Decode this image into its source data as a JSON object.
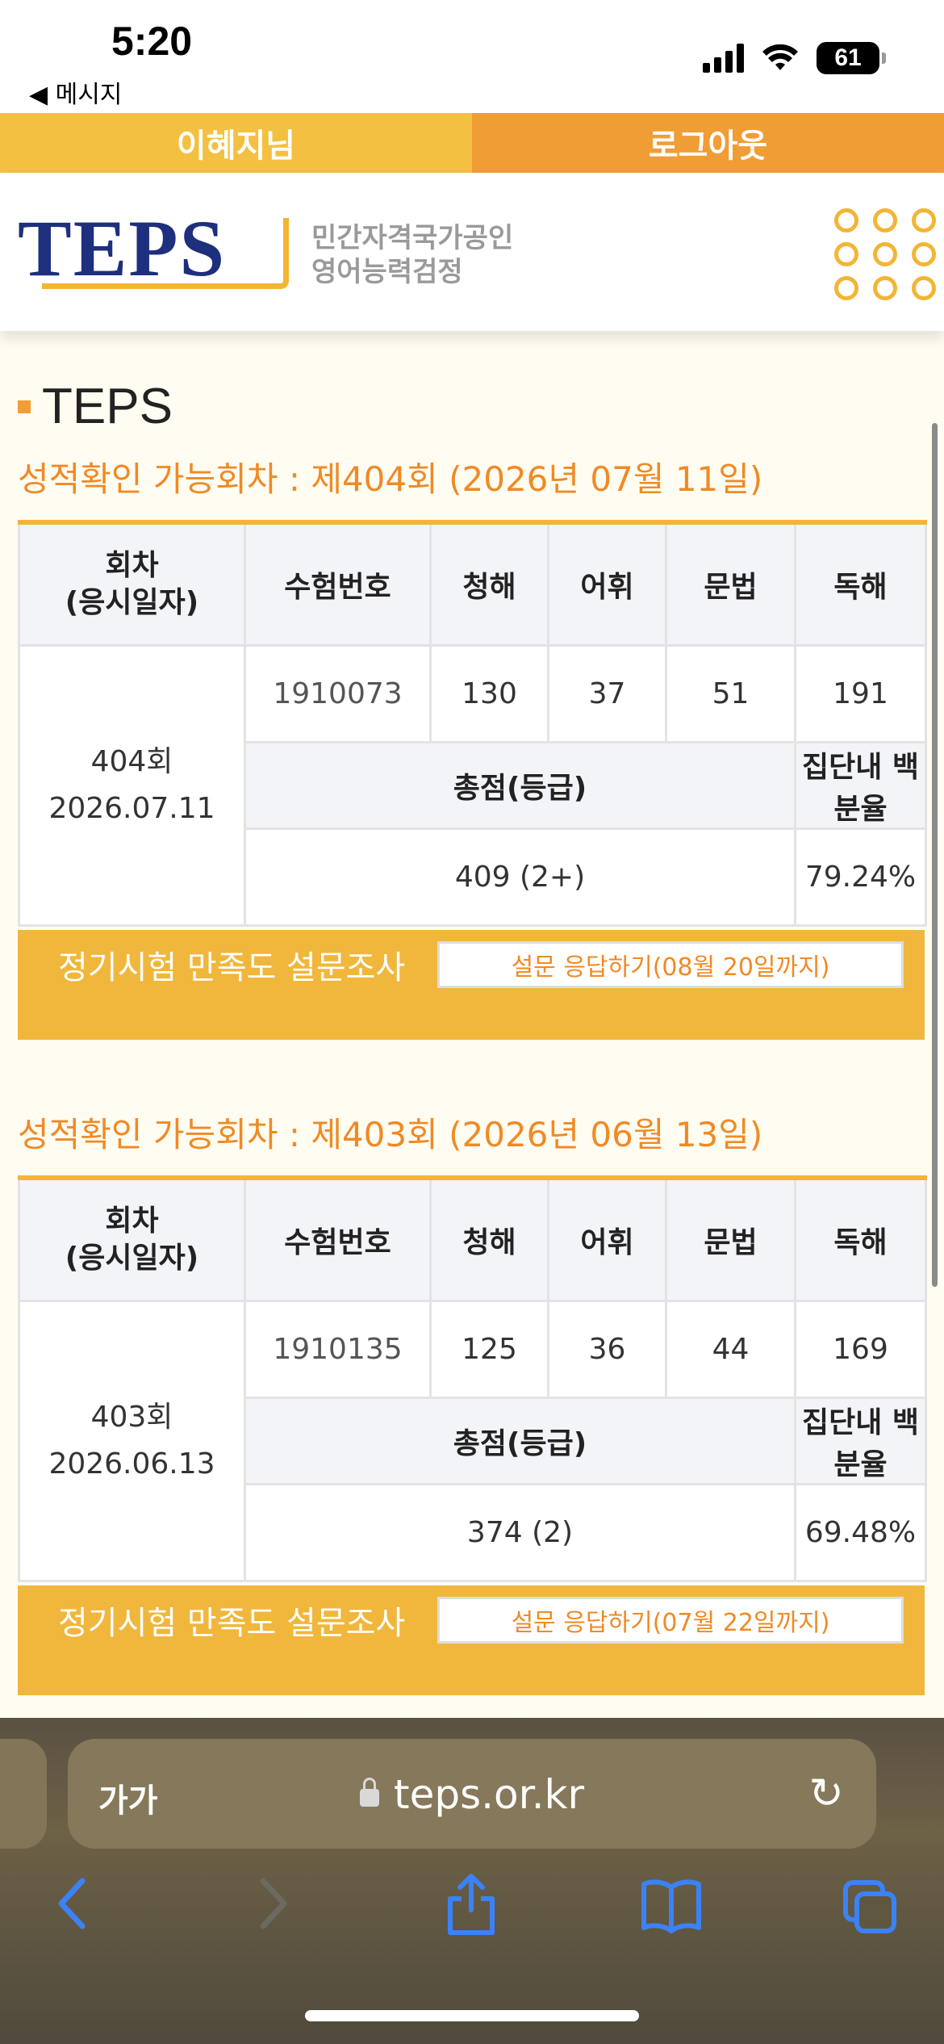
{
  "status_bar": {
    "time": "5:20",
    "back_label": "◀ 메시지",
    "battery": "61"
  },
  "topbar": {
    "user": "이혜지님",
    "logout": "로그아웃"
  },
  "header": {
    "logo": "TEPS",
    "sub_line1": "민간자격국가공인",
    "sub_line2": "영어능력검정"
  },
  "section_title": "TEPS",
  "table_headers": {
    "round_date": "회차\n(응시일자)",
    "exam_no": "수험번호",
    "listening": "청해",
    "vocab": "어휘",
    "grammar": "문법",
    "reading": "독해",
    "total": "총점(등급)",
    "percentile": "집단내 백분율"
  },
  "records": [
    {
      "title": "성적확인 가능회차 : 제404회 (2026년 07월 11일)",
      "round": "404회",
      "date": "2026.07.11",
      "exam_no": "1910073",
      "listening": "130",
      "vocab": "37",
      "grammar": "51",
      "reading": "191",
      "total": "409 (2+)",
      "percentile": "79.24%",
      "survey_label": "정기시험 만족도 설문조사",
      "survey_button": "설문 응답하기(08월 20일까지)"
    },
    {
      "title": "성적확인 가능회차 : 제403회 (2026년 06월 13일)",
      "round": "403회",
      "date": "2026.06.13",
      "exam_no": "1910135",
      "listening": "125",
      "vocab": "36",
      "grammar": "44",
      "reading": "169",
      "total": "374 (2)",
      "percentile": "69.48%",
      "survey_label": "정기시험 만족도 설문조사",
      "survey_button": "설문 응답하기(07월 22일까지)"
    }
  ],
  "browser": {
    "aa": "가가",
    "url": "teps.or.kr",
    "reload_icon": "↻"
  }
}
